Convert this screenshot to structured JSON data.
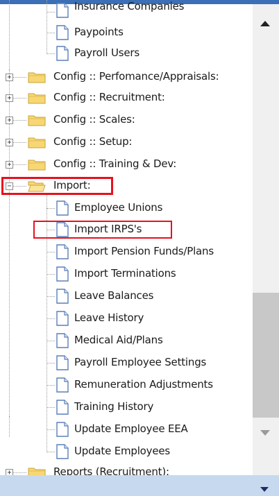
{
  "tree": {
    "top_items": [
      {
        "label": "Insurance Companies"
      },
      {
        "label": "Paypoints"
      },
      {
        "label": "Payroll Users"
      }
    ],
    "config_folders": [
      {
        "label": "Config :: Perfomance/Appraisals:"
      },
      {
        "label": "Config :: Recruitment:"
      },
      {
        "label": "Config :: Scales:"
      },
      {
        "label": "Config :: Setup:"
      },
      {
        "label": "Config :: Training & Dev:"
      }
    ],
    "import_folder": {
      "label": "Import:",
      "expanded": true
    },
    "import_children": [
      {
        "label": "Employee Unions"
      },
      {
        "label": "Import IRPS's"
      },
      {
        "label": "Import Pension Funds/Plans"
      },
      {
        "label": "Import Terminations"
      },
      {
        "label": "Leave Balances"
      },
      {
        "label": "Leave History"
      },
      {
        "label": "Medical Aid/Plans"
      },
      {
        "label": "Payroll Employee Settings"
      },
      {
        "label": "Remuneration Adjustments"
      },
      {
        "label": "Training History"
      },
      {
        "label": "Update Employee EEA"
      },
      {
        "label": "Update Employees"
      }
    ],
    "reports_folder": {
      "label": "Reports (Recruitment):"
    }
  },
  "colors": {
    "highlight": "#e8101c",
    "folder_fill": "#f7d774",
    "folder_edge": "#c9a23a",
    "accent": "#3b6fb6"
  },
  "icons": {
    "folder": "folder-icon",
    "document": "document-icon",
    "expand": "plus-expander-icon",
    "collapse": "minus-expander-icon"
  }
}
